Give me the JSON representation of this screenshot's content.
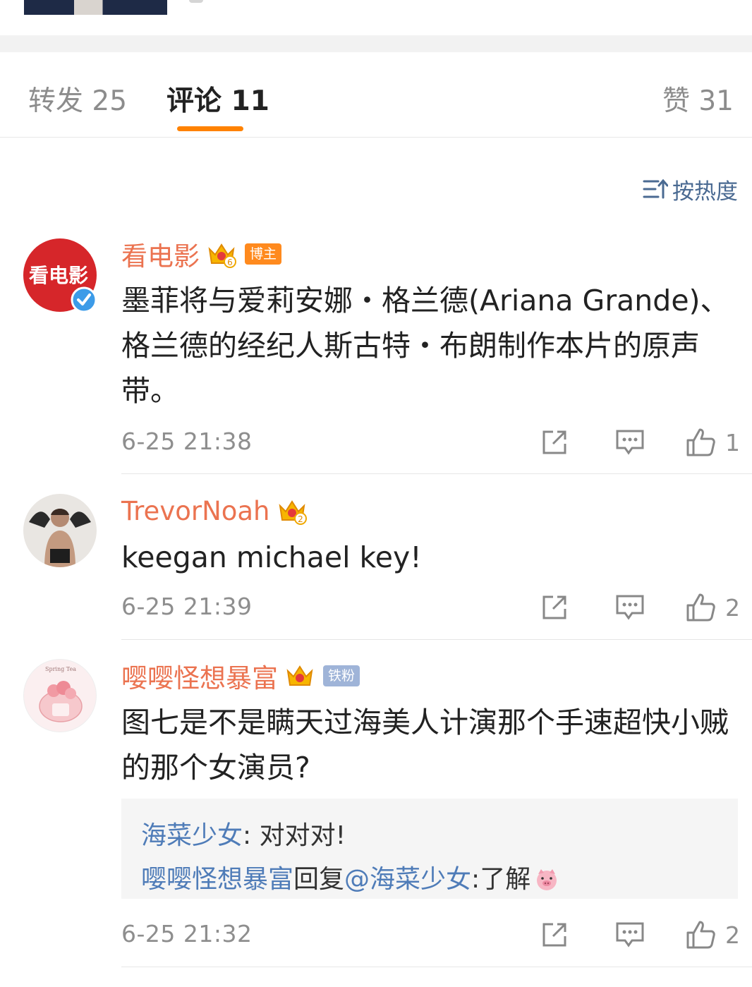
{
  "tabs": {
    "repost": "转发 25",
    "comment": "评论 11",
    "like": "赞 31"
  },
  "sort": {
    "label": "按热度"
  },
  "colors": {
    "accent": "#ff8200",
    "username": "#eb7350",
    "link": "#4f7cb8",
    "sort": "#4a6a92"
  },
  "comments": [
    {
      "avatar_text": "看电影",
      "name": "看电影",
      "crown_level": "6",
      "badge": "博主",
      "verified": true,
      "text": "墨菲将与爱莉安娜・格兰德(Ariana Grande)、格兰德的经纪人斯古特・布朗制作本片的原声带。",
      "time": "6-25 21:38",
      "likes": "1"
    },
    {
      "name": "TrevorNoah",
      "crown_level": "2",
      "text": "keegan michael key!",
      "time": "6-25 21:39",
      "likes": "2"
    },
    {
      "avatar_text": "Spring Tea",
      "name": "嘤嘤怪想暴富",
      "crown_level": "",
      "badge": "铁粉",
      "text": "图七是不是瞒天过海美人计演那个手速超快小贼的那个女演员?",
      "replies": [
        {
          "author": "海菜少女",
          "sep": ": ",
          "text": "对对对!"
        },
        {
          "author": "嘤嘤怪想暴富",
          "mid": "回复",
          "mention": "@海菜少女",
          "sep": ":",
          "text": "了解"
        }
      ],
      "time": "6-25 21:32",
      "likes": "2"
    }
  ]
}
